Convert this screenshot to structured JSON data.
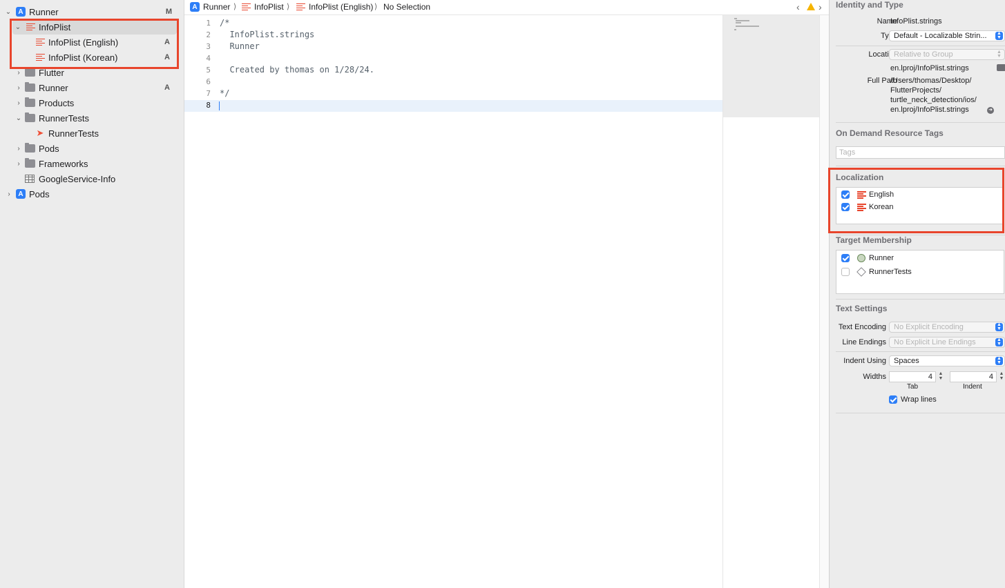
{
  "navigator": {
    "items": [
      {
        "label": "Runner",
        "badge": "M",
        "icon": "project-icon",
        "expanded": true
      },
      {
        "label": "InfoPlist",
        "badge": "",
        "icon": "strings-file-icon",
        "expanded": true,
        "selected": true
      },
      {
        "label": "InfoPlist (English)",
        "badge": "A",
        "icon": "strings-file-icon"
      },
      {
        "label": "InfoPlist (Korean)",
        "badge": "A",
        "icon": "strings-file-icon"
      },
      {
        "label": "Flutter",
        "badge": "",
        "icon": "folder-icon",
        "expanded": false
      },
      {
        "label": "Runner",
        "badge": "A",
        "icon": "folder-icon",
        "expanded": false
      },
      {
        "label": "Products",
        "badge": "",
        "icon": "folder-icon",
        "expanded": false
      },
      {
        "label": "RunnerTests",
        "badge": "",
        "icon": "folder-icon",
        "expanded": true
      },
      {
        "label": "RunnerTests",
        "badge": "",
        "icon": "swift-file-icon"
      },
      {
        "label": "Pods",
        "badge": "",
        "icon": "folder-icon",
        "expanded": false
      },
      {
        "label": "Frameworks",
        "badge": "",
        "icon": "folder-icon",
        "expanded": false
      },
      {
        "label": "GoogleService-Info",
        "badge": "",
        "icon": "plist-icon"
      },
      {
        "label": "Pods",
        "badge": "",
        "icon": "project-icon",
        "expanded": false
      }
    ]
  },
  "jumpbar": {
    "crumbs": [
      "Runner",
      "InfoPlist",
      "InfoPlist (English)",
      "No Selection"
    ]
  },
  "editor": {
    "lines": [
      {
        "num": "1",
        "text": "/*"
      },
      {
        "num": "2",
        "text": "  InfoPlist.strings"
      },
      {
        "num": "3",
        "text": "  Runner"
      },
      {
        "num": "4",
        "text": ""
      },
      {
        "num": "5",
        "text": "  Created by thomas on 1/28/24."
      },
      {
        "num": "6",
        "text": ""
      },
      {
        "num": "7",
        "text": "*/"
      },
      {
        "num": "8",
        "text": ""
      }
    ],
    "current_line": "8"
  },
  "inspector": {
    "identity": {
      "title": "Identity and Type",
      "name_label": "Name",
      "name_value": "InfoPlist.strings",
      "type_label": "Type",
      "type_value": "Default - Localizable Strin...",
      "location_label": "Location",
      "location_value": "Relative to Group",
      "location_path": "en.lproj/InfoPlist.strings",
      "fullpath_label": "Full Path",
      "fullpath_lines": [
        "/Users/thomas/Desktop/",
        "FlutterProjects/",
        "turtle_neck_detection/ios/",
        "en.lproj/InfoPlist.strings"
      ]
    },
    "odr": {
      "title": "On Demand Resource Tags",
      "placeholder": "Tags"
    },
    "localization": {
      "title": "Localization",
      "items": [
        {
          "label": "English",
          "checked": true
        },
        {
          "label": "Korean",
          "checked": true
        }
      ]
    },
    "membership": {
      "title": "Target Membership",
      "items": [
        {
          "label": "Runner",
          "checked": true
        },
        {
          "label": "RunnerTests",
          "checked": false
        }
      ]
    },
    "text_settings": {
      "title": "Text Settings",
      "encoding_label": "Text Encoding",
      "encoding_value": "No Explicit Encoding",
      "endings_label": "Line Endings",
      "endings_value": "No Explicit Line Endings",
      "indent_label": "Indent Using",
      "indent_value": "Spaces",
      "widths_label": "Widths",
      "tab_value": "4",
      "tab_label": "Tab",
      "indent_width_value": "4",
      "indent_width_label": "Indent",
      "wrap_label": "Wrap lines",
      "wrap_checked": true
    }
  },
  "colors": {
    "highlight": "#e8452c",
    "accent": "#2d7ef7"
  }
}
